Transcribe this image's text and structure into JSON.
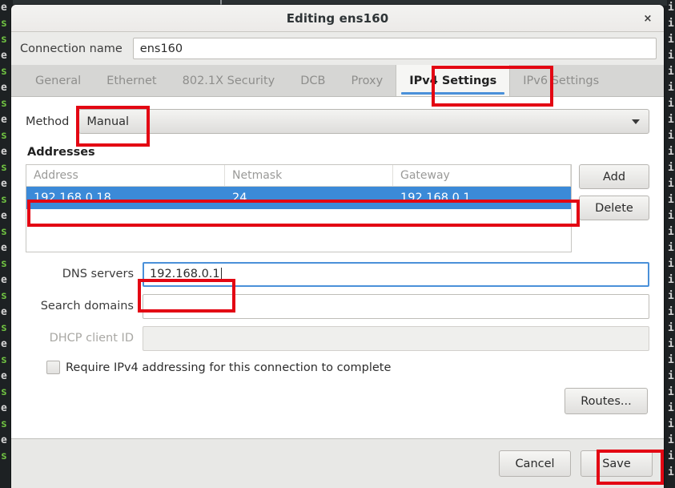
{
  "window": {
    "title": "Editing ens160",
    "close_label": "×"
  },
  "connection": {
    "label": "Connection name",
    "value": "ens160"
  },
  "tabs": [
    {
      "label": "General",
      "active": false
    },
    {
      "label": "Ethernet",
      "active": false
    },
    {
      "label": "802.1X Security",
      "active": false
    },
    {
      "label": "DCB",
      "active": false
    },
    {
      "label": "Proxy",
      "active": false
    },
    {
      "label": "IPv4 Settings",
      "active": true
    },
    {
      "label": "IPv6 Settings",
      "active": false
    }
  ],
  "method": {
    "label": "Method",
    "value": "Manual"
  },
  "addresses": {
    "section_title": "Addresses",
    "columns": [
      "Address",
      "Netmask",
      "Gateway"
    ],
    "rows": [
      {
        "address": "192.168.0.18",
        "netmask": "24",
        "gateway": "192.168.0.1",
        "selected": true
      }
    ],
    "add_label": "Add",
    "delete_label": "Delete"
  },
  "fields": {
    "dns_label": "DNS servers",
    "dns_value": "192.168.0.1",
    "search_label": "Search domains",
    "search_value": "",
    "dhcp_label": "DHCP client ID",
    "dhcp_value": ""
  },
  "require_ipv4": {
    "label": "Require IPv4 addressing for this connection to complete",
    "checked": false
  },
  "routes": {
    "label": "Routes..."
  },
  "footer": {
    "cancel_label": "Cancel",
    "save_label": "Save"
  },
  "colors": {
    "selection_blue": "#3b8ad8",
    "accent_underline": "#4a90d9",
    "annotation_red": "#e30613",
    "window_bg": "#f0f0ee",
    "tabstrip_bg": "#d6d6d4",
    "terminal_green": "#6fc142"
  },
  "background_terminal": {
    "left_chars": [
      "e",
      "s",
      "s",
      "e",
      "s",
      "e",
      "s",
      "e",
      "s",
      "e",
      "s",
      "e",
      "s",
      "e",
      "s",
      "e",
      "s",
      "e",
      "s",
      "e",
      "s",
      "e",
      "s",
      "e",
      "s",
      "e",
      "s",
      "e",
      "s"
    ],
    "right_chars": [
      "i",
      "i",
      "i",
      "i",
      "i",
      "i",
      "i",
      "i",
      "i",
      "i",
      "i",
      "i",
      "i",
      "i",
      "i",
      "i",
      "i",
      "i",
      "i",
      "i",
      "i",
      "i",
      "i",
      "i",
      "i",
      "i",
      "i",
      "i",
      "i",
      "i"
    ]
  }
}
